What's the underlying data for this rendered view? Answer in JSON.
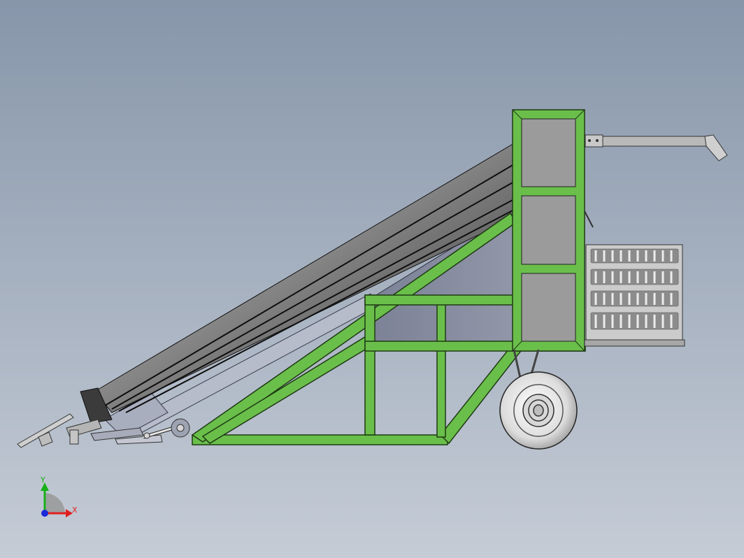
{
  "triad": {
    "x_label": "X",
    "y_label": "Y",
    "x_color": "#e02020",
    "y_color": "#18b018",
    "z_color": "#1a2ad8"
  },
  "colors": {
    "frame_green": "#6abf4b",
    "frame_edge": "#1e3a12",
    "hopper_gray": "#9b9b9b",
    "belt_dark": "#2a2a2a",
    "wheel_light": "#e8e8e8",
    "crate_gray": "#c9c9c9"
  },
  "icons": {
    "triad": "coordinate-triad-icon"
  }
}
